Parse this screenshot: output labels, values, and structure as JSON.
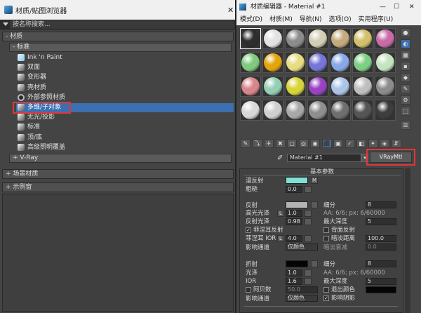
{
  "left_window": {
    "title": "材质/贴图浏览器",
    "search_placeholder": "按名称搜索...",
    "section_materials": "- 材质",
    "subsection_standard": "- 标准",
    "items": [
      "Ink 'n Paint",
      "双面",
      "变形器",
      "壳材质",
      "外部参照材质",
      "多维/子对象",
      "无光/投影",
      "标准",
      "顶/底",
      "高级照明覆盖"
    ],
    "selected_index": 5,
    "subsection_vray": "+ V-Ray",
    "section_scene": "+ 场景材质",
    "section_sample": "+ 示例窗",
    "close_glyph": "✕"
  },
  "right_window": {
    "title": "材质编辑器 - Material #1",
    "menu": [
      "模式(D)",
      "材质(M)",
      "导航(N)",
      "选项(O)",
      "实用程序(U)"
    ],
    "spheres": [
      "#2e2e2e",
      "#e2e2e2",
      "#8c8c8c",
      "#d3cfb6",
      "#c5aa7e",
      "#d2c06a",
      "#c86ba7",
      "#7fca7e",
      "#e3a40c",
      "#e7dc82",
      "#7576d8",
      "#89a8e8",
      "#7ecf83",
      "#c4e3c0",
      "#d8868c",
      "#94cfb4",
      "#d7d43a",
      "#9a42c4",
      "#aac5e8",
      "#bfbfbf",
      "#8c8c8c",
      "#d8d8d8",
      "#cfcfcf",
      "#a8a8a8",
      "#8f8f8f",
      "#6f6f6f",
      "#555555",
      "#3d3d3d"
    ],
    "material_name": "Material #1",
    "material_type": "VRayMtl",
    "rollout_title": "基本参数",
    "diffuse": {
      "label": "漫反射",
      "color": "#7fe0d4",
      "map": "M"
    },
    "roughness": {
      "label": "粗糙",
      "value": "0.0"
    },
    "reflect": {
      "label": "反射",
      "color": "#b3b3b3",
      "subdiv_label": "细分",
      "subdiv_value": "8"
    },
    "hilight": {
      "label": "高光光泽",
      "lock": "L",
      "value": "1.0",
      "aa_text": "AA: 6/6; px: 6/60000"
    },
    "refl_gloss": {
      "label": "反射光泽",
      "value": "0.98",
      "max_depth_label": "最大深度",
      "max_depth_value": "5"
    },
    "fresnel": {
      "label": "菲涅耳反射",
      "back_reflect_label": "背面反射"
    },
    "fresnel_ior": {
      "label": "菲涅耳 IOR",
      "lock": "L",
      "value": "4.0",
      "dim_dist_label": "暗淡距离",
      "dim_dist_value": "100.0"
    },
    "affect_channel": {
      "label": "影响通道",
      "value": "仅颜色",
      "dim_falloff_label": "暗淡衰减",
      "dim_falloff_value": "0.0"
    },
    "refract": {
      "label": "折射",
      "color": "#050505",
      "subdiv_label": "细分",
      "subdiv_value": "8"
    },
    "glossiness": {
      "label": "光泽",
      "value": "1.0",
      "aa_text": "AA: 6/6; px: 6/60000"
    },
    "ior": {
      "label": "IOR",
      "value": "1.6",
      "max_depth_label": "最大深度",
      "max_depth_value": "5"
    },
    "abbe": {
      "label": "阿贝数",
      "value": "50.0",
      "exit_color_label": "退出颜色"
    },
    "affect_channel2": {
      "label": "影响通道",
      "value": "仅颜色",
      "affect_shadow_label": "影响阴影"
    },
    "win_controls": [
      "—",
      "☐",
      "✕"
    ]
  },
  "colors": {
    "selected": "#3c6fb0",
    "highlight": "#e23636"
  }
}
